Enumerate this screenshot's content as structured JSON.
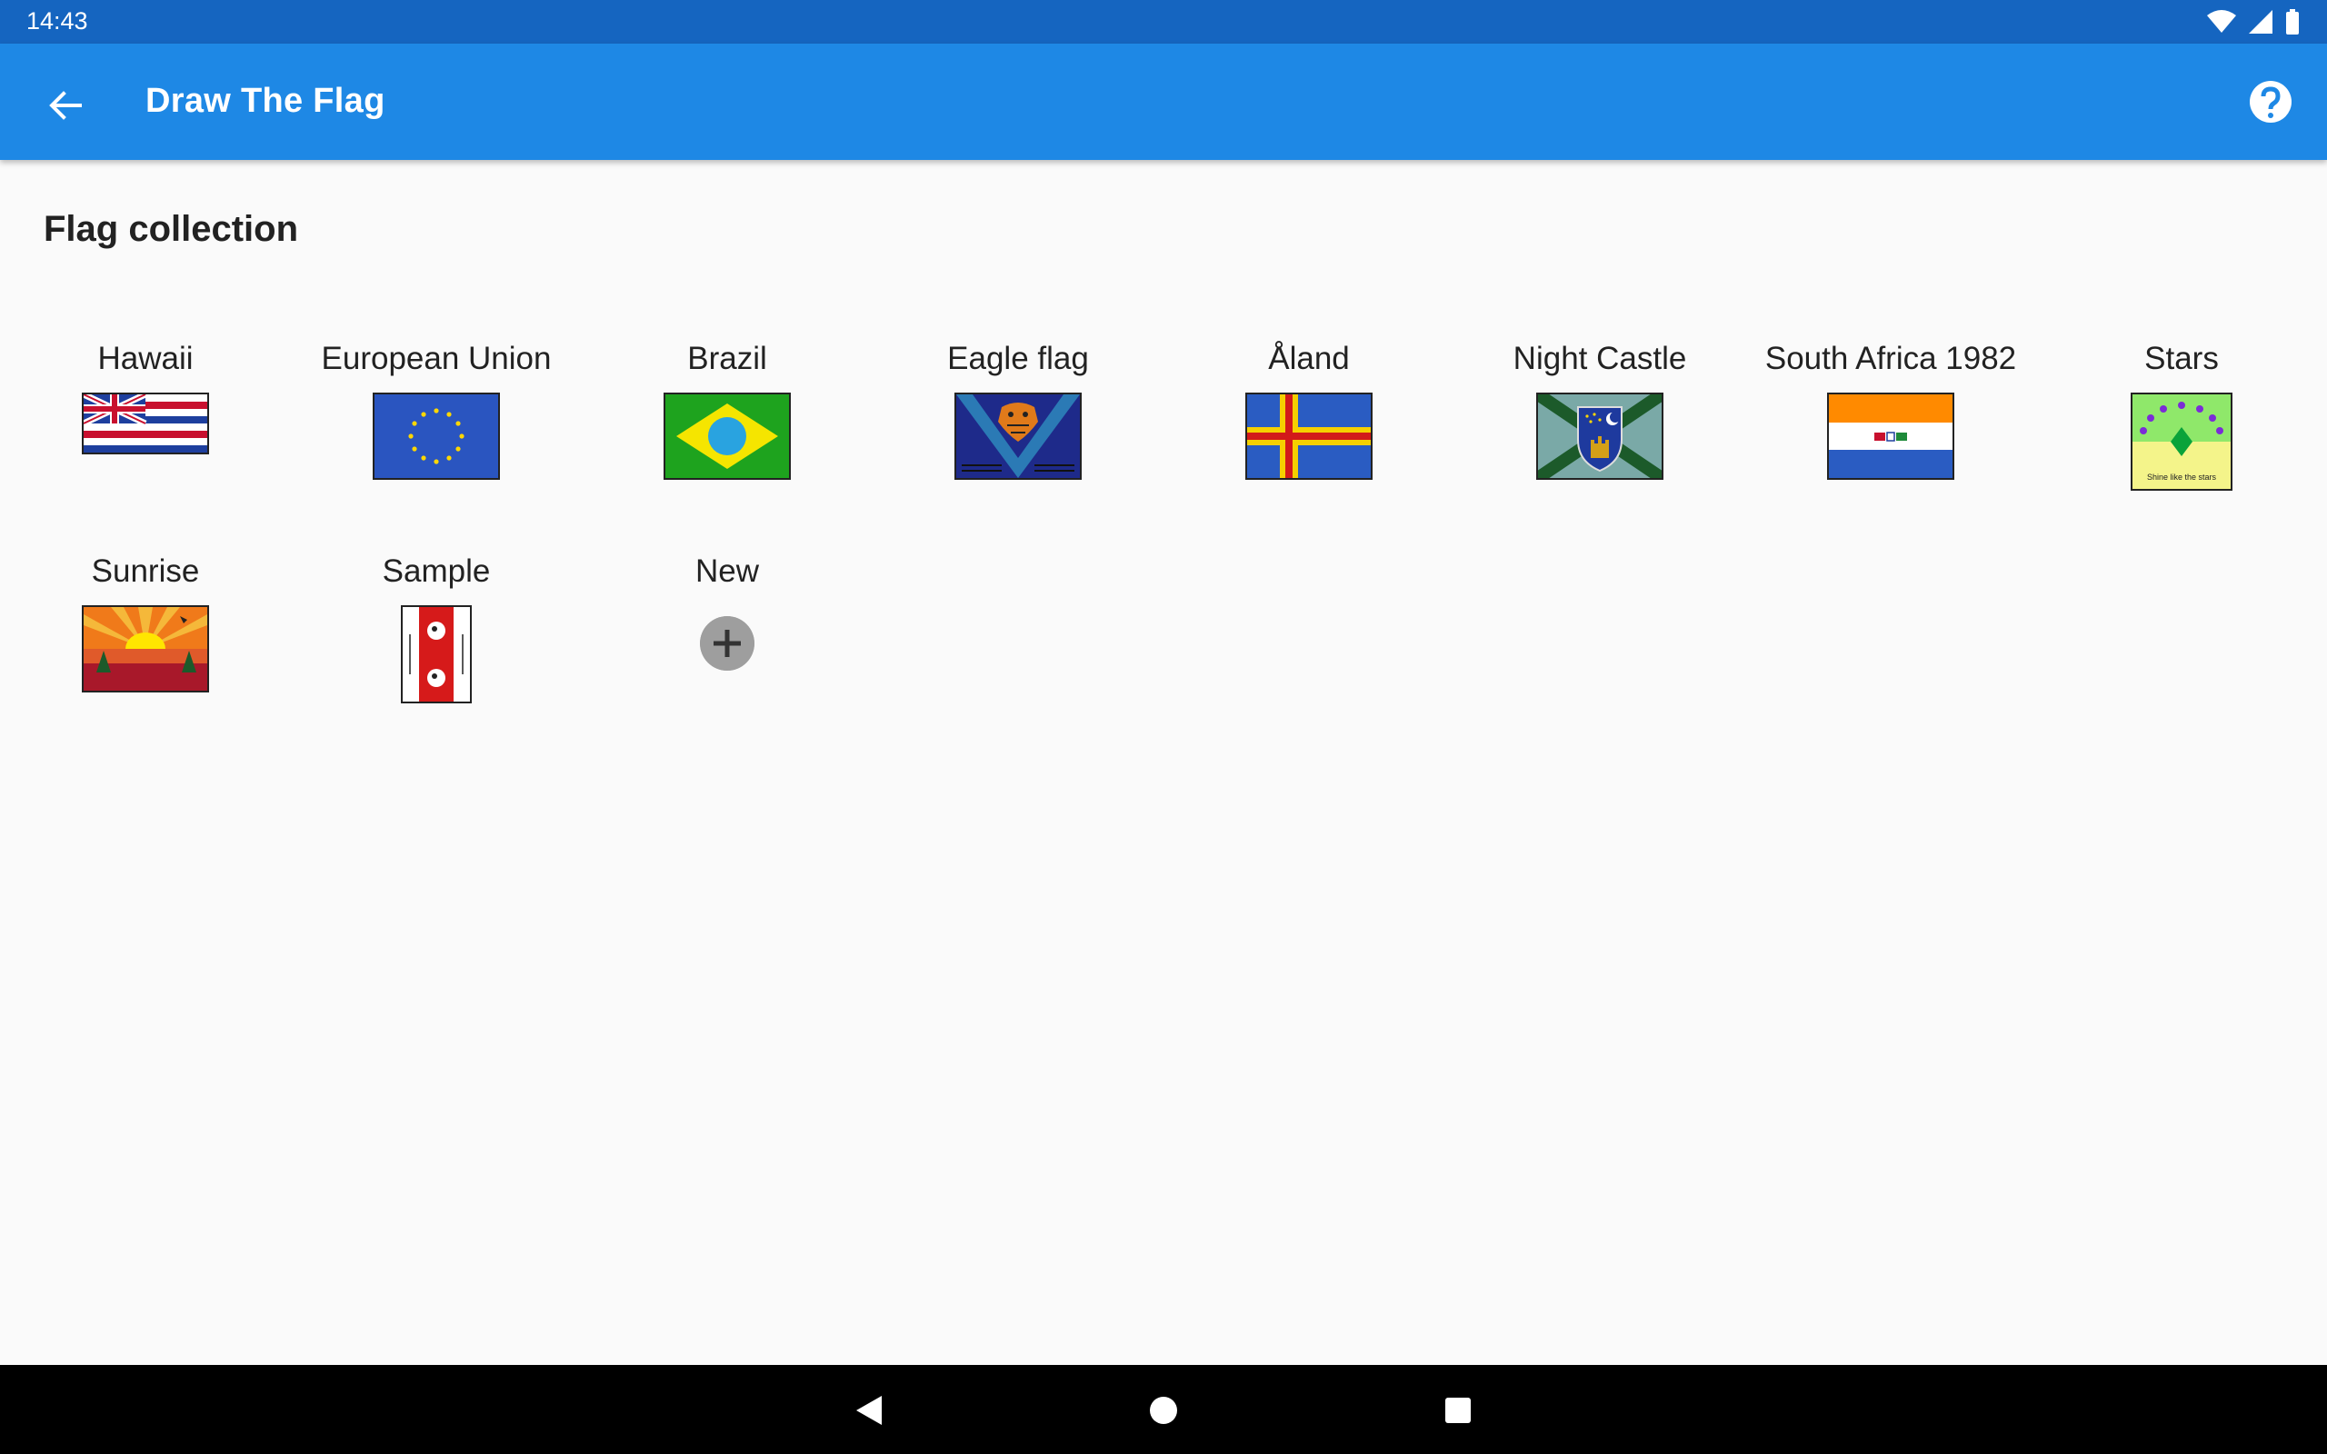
{
  "status_bar": {
    "time": "14:43",
    "icons": [
      "wifi-icon",
      "cell-signal-icon",
      "battery-icon"
    ]
  },
  "app_bar": {
    "title": "Draw The Flag",
    "back_icon": "arrow-left-icon",
    "help_icon": "help-circle-icon"
  },
  "section": {
    "title": "Flag collection"
  },
  "flags": [
    {
      "label": "Hawaii"
    },
    {
      "label": "European Union"
    },
    {
      "label": "Brazil"
    },
    {
      "label": "Eagle flag"
    },
    {
      "label": "Åland"
    },
    {
      "label": "Night Castle"
    },
    {
      "label": "South Africa 1982"
    },
    {
      "label": "Stars",
      "motto": "Shine like the stars"
    },
    {
      "label": "Sunrise"
    },
    {
      "label": "Sample"
    }
  ],
  "new_item": {
    "label": "New",
    "icon": "plus-icon"
  },
  "colors": {
    "status_bar": "#1565c0",
    "app_bar": "#1e88e5",
    "background": "#fafafa"
  },
  "nav_bar": {
    "icons": [
      "back-triangle-icon",
      "home-circle-icon",
      "recents-square-icon"
    ]
  }
}
